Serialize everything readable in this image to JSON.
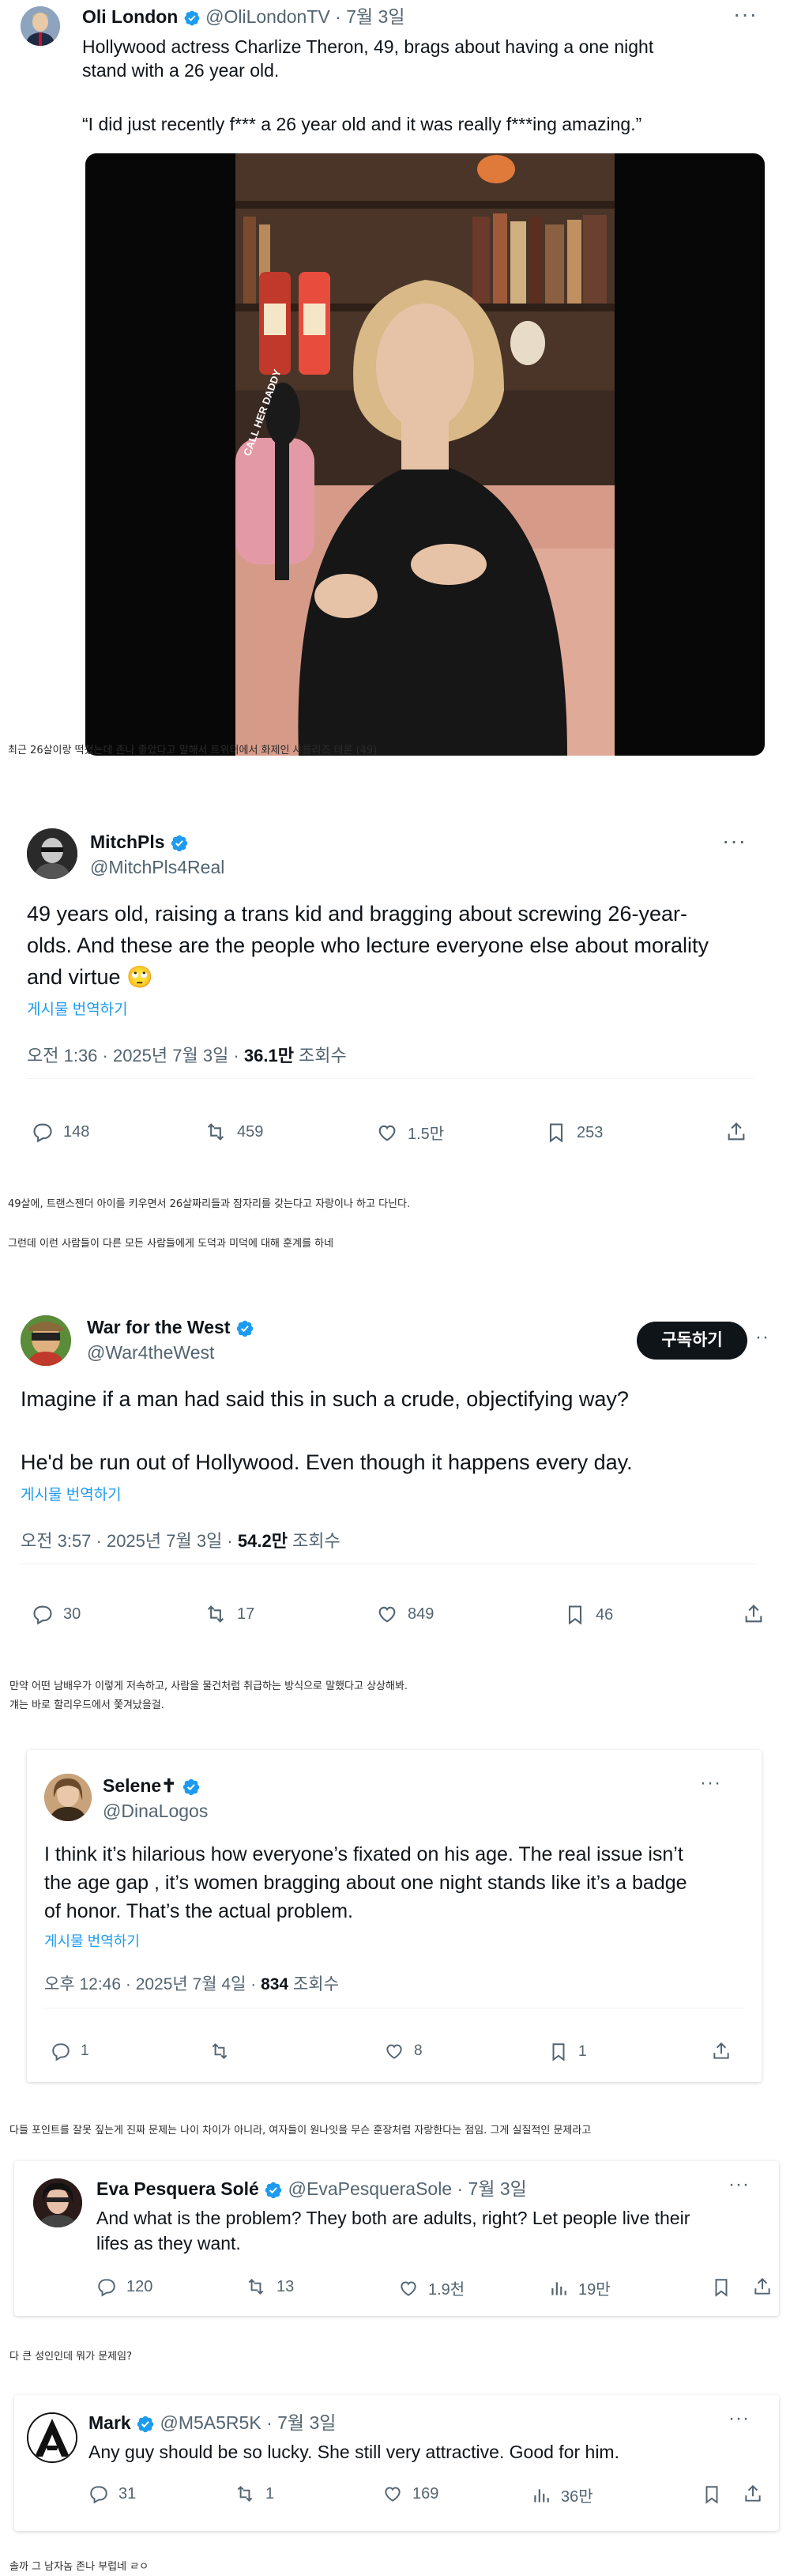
{
  "colors": {
    "accent": "#1d9bf0",
    "muted": "#536471",
    "text": "#0f1419",
    "button_bg": "#0f1419"
  },
  "tweet1": {
    "name": "Oli London",
    "handle": "@OliLondonTV",
    "dot_date": "· 7월 3일",
    "text_line1": "Hollywood actress Charlize Theron, 49, brags about having a one night",
    "text_line2": "stand with a 26 year old.",
    "quote": "“I did just recently f*** a 26 year old and it was really f***ing amazing.”",
    "caption": "최근 26살이랑 떡쳤는데 존나 좋았다고 말해서 트위터에서 화제인 샤를리즈 테론 (49)",
    "media_text": "CALL HER DADDY"
  },
  "tweet2": {
    "name": "MitchPls",
    "handle": "@MitchPls4Real",
    "text_line1": "49 years old, raising a trans kid and bragging about screwing 26-year-",
    "text_line2": "olds. And these are the people who lecture everyone else about morality",
    "text_line3": "and virtue 🙄",
    "translate": "게시물 번역하기",
    "time": "오전 1:36 · 2025년 7월 3일 · ",
    "views": "36.1만",
    "views_label": " 조회수",
    "replies": "148",
    "retweets": "459",
    "likes": "1.5만",
    "bookmarks": "253",
    "caption1": "49살에, 트랜스젠더 아이를 키우면서 26살짜리들과 잠자리를 갖는다고 자랑이나 하고 다닌다.",
    "caption2": "그런데 이런 사람들이 다른 모든 사람들에게 도덕과 미덕에 대해 훈계를 하네"
  },
  "tweet3": {
    "name": "War for the West",
    "handle": "@War4theWest",
    "subscribe": "구독하기",
    "text_line1": "Imagine if a man had said this in  such a crude, objectifying way?",
    "text_line2": "He'd be run out of Hollywood. Even though it happens every day.",
    "translate": "게시물 번역하기",
    "time": "오전 3:57 · 2025년 7월 3일 · ",
    "views": "54.2만",
    "views_label": " 조회수",
    "replies": "30",
    "retweets": "17",
    "likes": "849",
    "bookmarks": "46",
    "caption1": "만약 어떤 남배우가 이렇게 저속하고, 사람을 물건처럼 취급하는 방식으로 말했다고 상상해봐.",
    "caption2": "걔는 바로 할리우드에서 쫓겨났을걸."
  },
  "tweet4": {
    "name": "Selene✝",
    "handle": "@DinaLogos",
    "text_line1": "I think it’s hilarious how everyone’s fixated on his age. The real issue isn’t",
    "text_line2": "the age gap , it’s women bragging about one night stands like it’s a badge",
    "text_line3": "of honor. That’s the actual problem.",
    "translate": "게시물 번역하기",
    "time": "오후 12:46 · 2025년 7월 4일 · ",
    "views": "834",
    "views_label": " 조회수",
    "replies": "1",
    "retweets": "",
    "likes": "8",
    "bookmarks": "1",
    "caption": "다들 포인트를 잘못 짚는게 진짜 문제는 나이 차이가 아니라, 여자들이 원나잇을 무슨 훈장처럼 자랑한다는 점임. 그게 실질적인 문제라고"
  },
  "tweet5": {
    "name": "Eva Pesquera Solé",
    "handle": "@EvaPesqueraSole",
    "dot_date": "· 7월 3일",
    "text_line1": "And what is the problem? They both are adults, right? Let people live their",
    "text_line2": "lifes as they want.",
    "replies": "120",
    "retweets": "13",
    "likes": "1.9천",
    "views": "19만",
    "caption": "다 큰 성인인데 뭐가 문제임?"
  },
  "tweet6": {
    "name": "Mark",
    "handle": "@M5A5R5K",
    "dot_date": "· 7월 3일",
    "text_line1": "Any guy should be so lucky.  She still very attractive.  Good for him.",
    "replies": "31",
    "retweets": "1",
    "likes": "169",
    "views": "36만",
    "caption": "솔까 그 남자놈 존나 부럽네 ㄹㅇ"
  }
}
